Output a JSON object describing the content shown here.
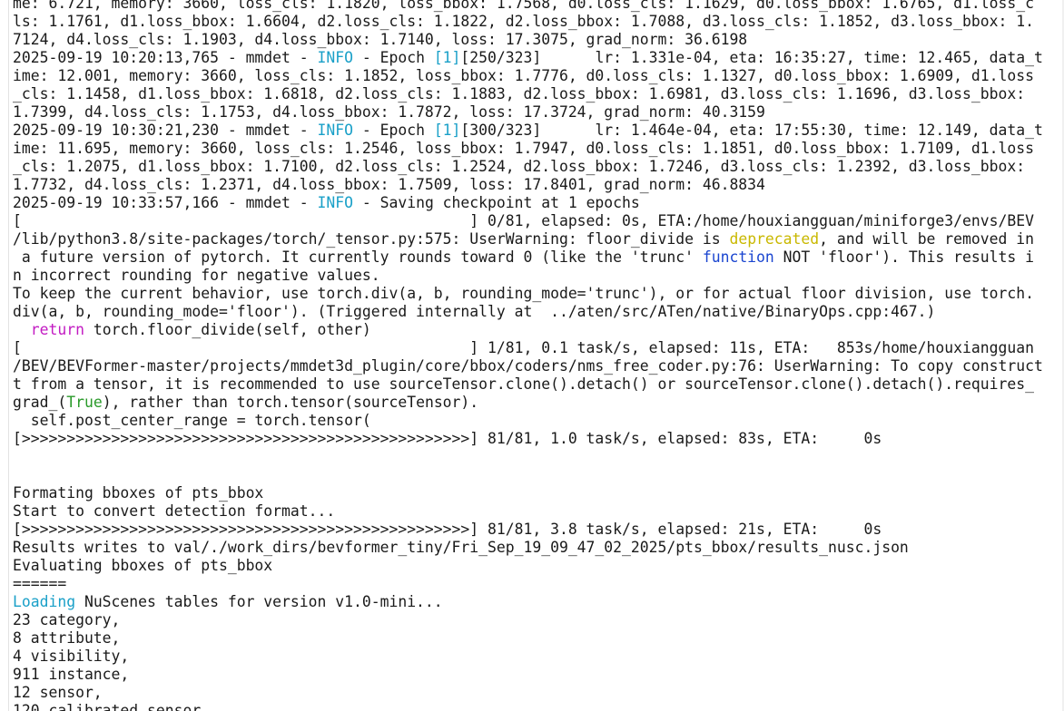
{
  "terminal": {
    "lines": [
      [
        {
          "t": "me: 6.721, memory: 3660, loss_cls: 1.1820, loss_bbox: 1.7568, d0.loss_cls: 1.1629, d0.loss_bbox: 1.6765, d1.loss_c"
        }
      ],
      [
        {
          "t": "ls: 1.1761, d1.loss_bbox: 1.6604, d2.loss_cls: 1.1822, d2.loss_bbox: 1.7088, d3.loss_cls: 1.1852, d3.loss_bbox: 1."
        }
      ],
      [
        {
          "t": "7124, d4.loss_cls: 1.1903, d4.loss_bbox: 1.7140, loss: 17.3075, grad_norm: 36.6198"
        }
      ],
      [
        {
          "t": "2025-09-19 10:20:13,765 - mmdet - "
        },
        {
          "t": "INFO",
          "c": "info"
        },
        {
          "t": " - Epoch "
        },
        {
          "t": "[1]",
          "c": "num"
        },
        {
          "t": "[250/323]      lr: 1.331e-04, eta: 16:35:27, time: 12.465, data_t"
        }
      ],
      [
        {
          "t": "ime: 12.001, memory: 3660, loss_cls: 1.1852, loss_bbox: 1.7776, d0.loss_cls: 1.1327, d0.loss_bbox: 1.6909, d1.loss"
        }
      ],
      [
        {
          "t": "_cls: 1.1458, d1.loss_bbox: 1.6818, d2.loss_cls: 1.1883, d2.loss_bbox: 1.6981, d3.loss_cls: 1.1696, d3.loss_bbox:"
        }
      ],
      [
        {
          "t": "1.7399, d4.loss_cls: 1.1753, d4.loss_bbox: 1.7872, loss: 17.3724, grad_norm: 40.3159"
        }
      ],
      [
        {
          "t": "2025-09-19 10:30:21,230 - mmdet - "
        },
        {
          "t": "INFO",
          "c": "info"
        },
        {
          "t": " - Epoch "
        },
        {
          "t": "[1]",
          "c": "num"
        },
        {
          "t": "[300/323]      lr: 1.464e-04, eta: 17:55:30, time: 12.149, data_t"
        }
      ],
      [
        {
          "t": "ime: 11.695, memory: 3660, loss_cls: 1.2546, loss_bbox: 1.7947, d0.loss_cls: 1.1851, d0.loss_bbox: 1.7109, d1.loss"
        }
      ],
      [
        {
          "t": "_cls: 1.2075, d1.loss_bbox: 1.7100, d2.loss_cls: 1.2524, d2.loss_bbox: 1.7246, d3.loss_cls: 1.2392, d3.loss_bbox:"
        }
      ],
      [
        {
          "t": "1.7732, d4.loss_cls: 1.2371, d4.loss_bbox: 1.7509, loss: 17.8401, grad_norm: 46.8834"
        }
      ],
      [
        {
          "t": "2025-09-19 10:33:57,166 - mmdet - "
        },
        {
          "t": "INFO",
          "c": "info"
        },
        {
          "t": " - Saving checkpoint at 1 epochs"
        }
      ],
      [
        {
          "t": "[                                                  ] 0/81, elapsed: 0s, ETA:/home/houxiangguan/miniforge3/envs/BEV"
        }
      ],
      [
        {
          "t": "/lib/python3.8/site-packages/torch/_tensor.py:575: UserWarning: floor_divide is "
        },
        {
          "t": "deprecated",
          "c": "warn"
        },
        {
          "t": ", and will be removed in"
        }
      ],
      [
        {
          "t": " a future version of pytorch. It currently rounds toward 0 (like the 'trunc' "
        },
        {
          "t": "function",
          "c": "fn"
        },
        {
          "t": " NOT 'floor'). This results i"
        }
      ],
      [
        {
          "t": "n incorrect rounding for negative values."
        }
      ],
      [
        {
          "t": "To keep the current behavior, use torch.div(a, b, rounding_mode='trunc'), or for actual floor division, use torch."
        }
      ],
      [
        {
          "t": "div(a, b, rounding_mode='floor'). (Triggered internally at  ../aten/src/ATen/native/BinaryOps.cpp:467.)"
        }
      ],
      [
        {
          "t": "  "
        },
        {
          "t": "return",
          "c": "kw"
        },
        {
          "t": " torch.floor_divide(self, other)"
        }
      ],
      [
        {
          "t": "[                                                  ] 1/81, 0.1 task/s, elapsed: 11s, ETA:   853s/home/houxiangguan"
        }
      ],
      [
        {
          "t": "/BEV/BEVFormer-master/projects/mmdet3d_plugin/core/bbox/coders/nms_free_coder.py:76: UserWarning: To copy construct"
        }
      ],
      [
        {
          "t": "t from a tensor, it is recommended to use sourceTensor.clone().detach() or sourceTensor.clone().detach().requires_"
        }
      ],
      [
        {
          "t": "grad_("
        },
        {
          "t": "True",
          "c": "tru"
        },
        {
          "t": "), rather than torch.tensor(sourceTensor)."
        }
      ],
      [
        {
          "t": "  self.post_center_range = torch.tensor("
        }
      ],
      [
        {
          "t": "[>>>>>>>>>>>>>>>>>>>>>>>>>>>>>>>>>>>>>>>>>>>>>>>>>>] 81/81, 1.0 task/s, elapsed: 83s, ETA:     0s"
        }
      ],
      [
        {
          "t": ""
        }
      ],
      [
        {
          "t": ""
        }
      ],
      [
        {
          "t": "Formating bboxes of pts_bbox"
        }
      ],
      [
        {
          "t": "Start to convert detection format..."
        }
      ],
      [
        {
          "t": "[>>>>>>>>>>>>>>>>>>>>>>>>>>>>>>>>>>>>>>>>>>>>>>>>>>] 81/81, 3.8 task/s, elapsed: 21s, ETA:     0s"
        }
      ],
      [
        {
          "t": "Results writes to val/./work_dirs/bevformer_tiny/Fri_Sep_19_09_47_02_2025/pts_bbox/results_nusc.json"
        }
      ],
      [
        {
          "t": "Evaluating bboxes of pts_bbox"
        }
      ],
      [
        {
          "t": "======"
        }
      ],
      [
        {
          "t": "Loading",
          "c": "info"
        },
        {
          "t": " NuScenes tables for version v1.0-mini..."
        }
      ],
      [
        {
          "t": "23 category,"
        }
      ],
      [
        {
          "t": "8 attribute,"
        }
      ],
      [
        {
          "t": "4 visibility,"
        }
      ],
      [
        {
          "t": "911 instance,"
        }
      ],
      [
        {
          "t": "12 sensor,"
        }
      ],
      [
        {
          "t": "120 calibrated_sensor,"
        }
      ]
    ]
  }
}
